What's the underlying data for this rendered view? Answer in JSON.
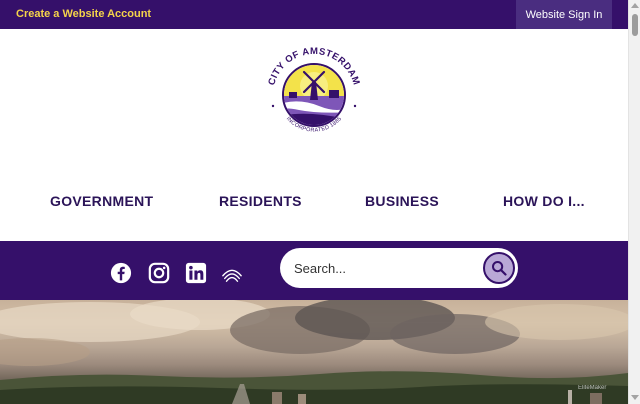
{
  "topbar": {
    "create_account": "Create a Website Account",
    "sign_in": "Website Sign In"
  },
  "logo": {
    "top_text": "CITY OF AMSTERDAM",
    "bottom_text": "INCORPORATED 1885"
  },
  "nav": {
    "items": [
      {
        "label": "GOVERNMENT"
      },
      {
        "label": "RESIDENTS"
      },
      {
        "label": "BUSINESS"
      },
      {
        "label": "HOW DO I..."
      }
    ]
  },
  "social": {
    "icons": [
      "facebook-icon",
      "instagram-icon",
      "linkedin-icon",
      "waves-icon"
    ]
  },
  "search": {
    "placeholder": "Search...",
    "value": ""
  },
  "hero": {
    "credit": "EliteMaker"
  },
  "colors": {
    "brand_purple": "#35106a",
    "accent_yellow": "#f5d34a",
    "button_lavender": "#b9a8d6"
  }
}
